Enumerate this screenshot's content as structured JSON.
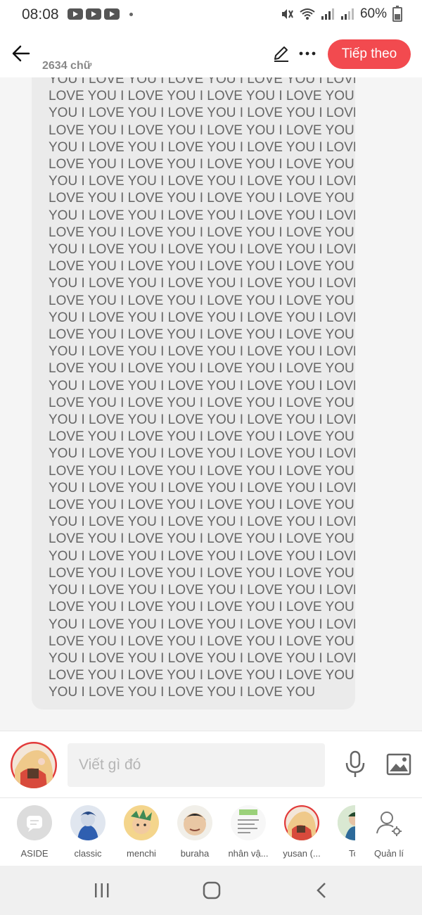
{
  "status_bar": {
    "time": "08:08",
    "battery": "60%"
  },
  "header": {
    "word_count": "2634 chữ",
    "next_label": "Tiếp theo"
  },
  "content": {
    "repeat_unit": "I LOVE YOU ",
    "repeat_count": 240,
    "end_text": "YOU I LOVE YOU I LOVE YOU I LOVE YOU"
  },
  "composer": {
    "placeholder": "Viết gì đó"
  },
  "characters": [
    {
      "name": "ASIDE"
    },
    {
      "name": "classic"
    },
    {
      "name": "menchi"
    },
    {
      "name": "buraha"
    },
    {
      "name": "nhân vậ..."
    },
    {
      "name": "yusan (..."
    },
    {
      "name": "Tor"
    }
  ],
  "manage_label": "Quản lí",
  "colors": {
    "accent": "#f24a4f",
    "card": "#ebebeb",
    "text": "#666666"
  },
  "icons": {
    "back": "arrow-left-icon",
    "edit": "pencil-icon",
    "more": "more-dots-icon",
    "mic": "microphone-icon",
    "image": "image-icon",
    "aside": "chat-bubble-icon",
    "manage": "user-gear-icon"
  }
}
